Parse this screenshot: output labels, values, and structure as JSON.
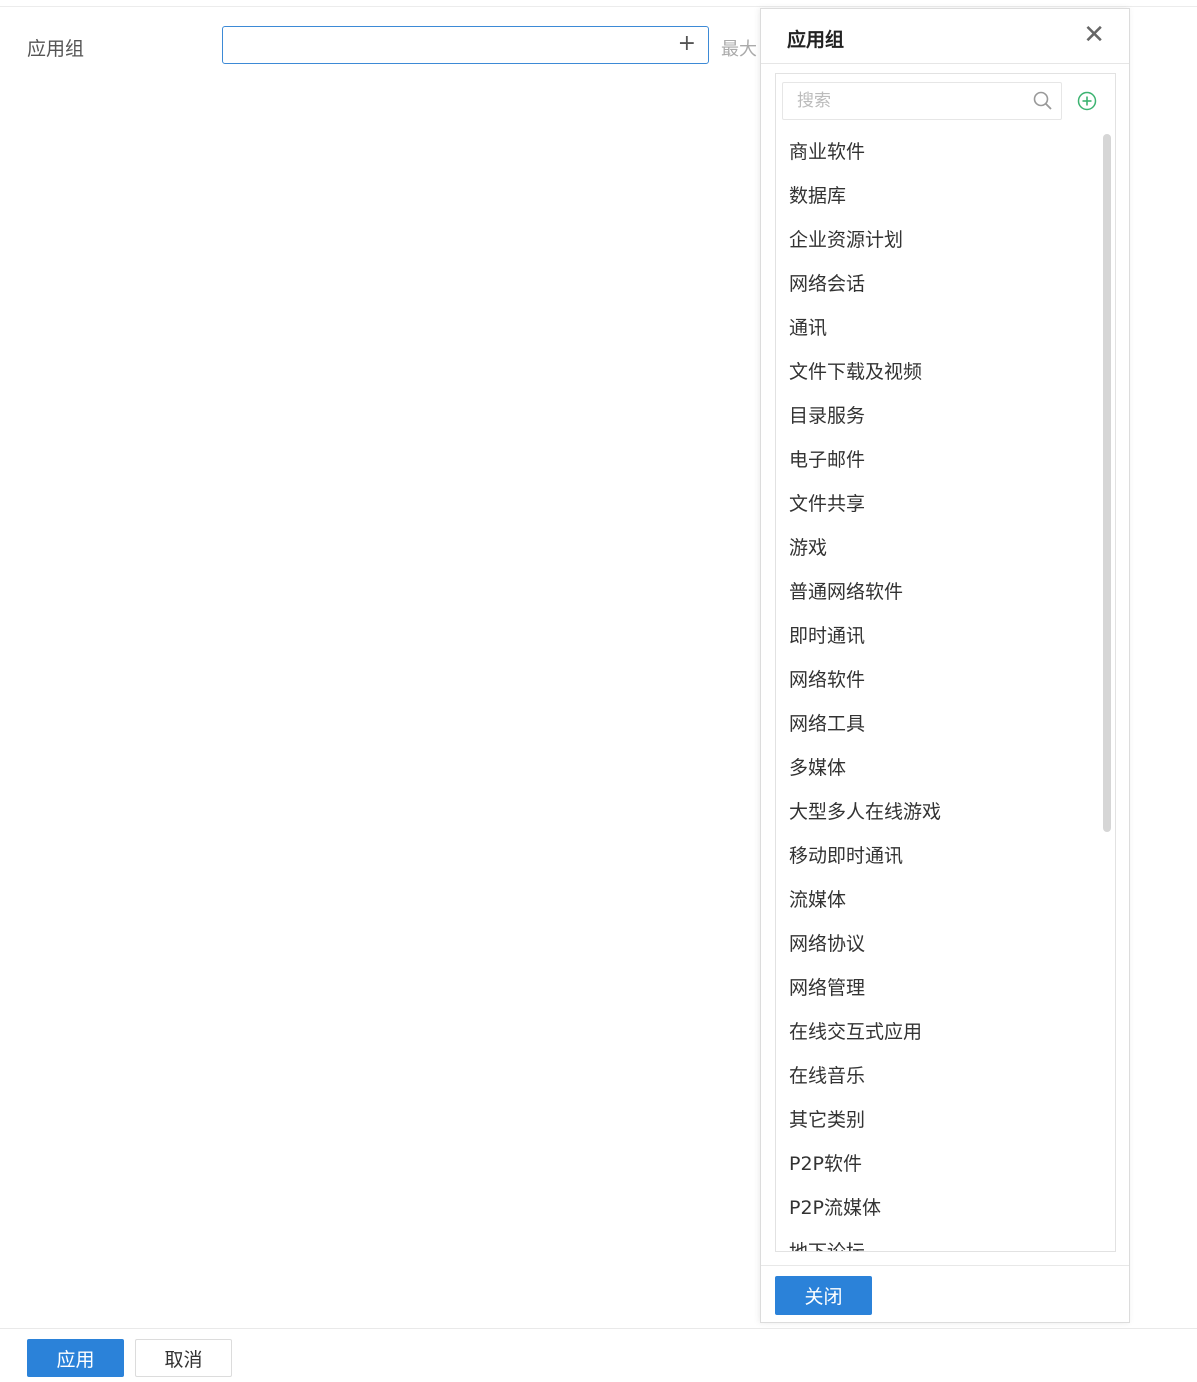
{
  "form": {
    "label": "应用组",
    "input_value": "",
    "add_symbol": "+",
    "max_hint": "最大"
  },
  "panel": {
    "title": "应用组",
    "close_symbol": "✕",
    "search_placeholder": "搜索",
    "items": [
      "商业软件",
      "数据库",
      "企业资源计划",
      "网络会话",
      "通讯",
      "文件下载及视频",
      "目录服务",
      "电子邮件",
      "文件共享",
      "游戏",
      "普通网络软件",
      "即时通讯",
      "网络软件",
      "网络工具",
      "多媒体",
      "大型多人在线游戏",
      "移动即时通讯",
      "流媒体",
      "网络协议",
      "网络管理",
      "在线交互式应用",
      "在线音乐",
      "其它类别",
      "P2P软件",
      "P2P流媒体",
      "地下论坛"
    ],
    "close_button": "关闭"
  },
  "footer": {
    "apply_button": "应用",
    "cancel_button": "取消"
  },
  "colors": {
    "primary": "#2b82d9",
    "focus_border": "#3d8ad6",
    "add_icon": "#3cb371"
  },
  "icons": {
    "search": "search-icon",
    "add": "add-circle-icon",
    "close": "close-icon"
  }
}
